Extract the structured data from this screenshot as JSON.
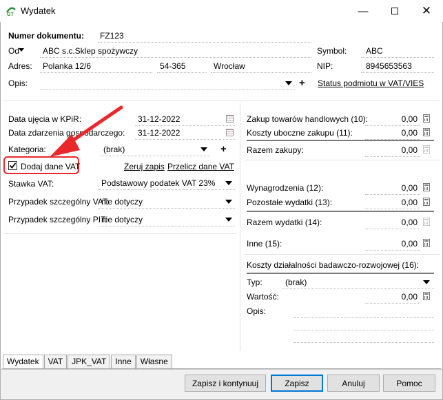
{
  "window": {
    "title": "Wydatek"
  },
  "header": {
    "doc_number_label": "Numer dokumentu:",
    "doc_number": "FZ123",
    "from_label": "Od",
    "from_value": "ABC s.c.Sklep spożywczy",
    "symbol_label": "Symbol:",
    "symbol_value": "ABC",
    "address_label": "Adres:",
    "street": "Polanka  12/6",
    "postcode": "54-365",
    "city": "Wrocław",
    "nip_label": "NIP:",
    "nip_value": "8945653563",
    "desc_label": "Opis:",
    "desc_value": "",
    "vat_status_link": "Status podmiotu w VAT/VIES"
  },
  "left": {
    "kpir_date_label": "Data ujęcia w KPiR:",
    "kpir_date": "31-12-2022",
    "event_date_label": "Data zdarzenia gospodarczego:",
    "event_date": "31-12-2022",
    "category_label": "Kategoria:",
    "category_value": "(brak)",
    "add_vat_label": "Dodaj dane VAT",
    "clear_link": "Zeruj zapis",
    "recalc_link": "Przelicz dane VAT",
    "vat_rate_label": "Stawka VAT:",
    "vat_rate_value": "Podstawowy podatek VAT 23%",
    "special_vat_label": "Przypadek szczególny VAT:",
    "special_vat_value": "nie dotyczy",
    "special_pit_label": "Przypadek szczególny PIT:",
    "special_pit_value": "nie dotyczy"
  },
  "right": {
    "goods_label": "Zakup towarów handlowych (10):",
    "goods_value": "0,00",
    "side_costs_label": "Koszty uboczne zakupu (11):",
    "side_costs_value": "0,00",
    "total_purchase_label": "Razem zakupy:",
    "total_purchase_value": "0,00",
    "salaries_label": "Wynagrodzenia (12):",
    "salaries_value": "0,00",
    "other_exp_label": "Pozostałe wydatki (13):",
    "other_exp_value": "0,00",
    "total_exp_label": "Razem wydatki (14):",
    "total_exp_value": "0,00",
    "other_label": "Inne (15):",
    "other_value": "0,00",
    "rd_label": "Koszty działalności badawczo-rozwojowej (16):",
    "type_label": "Typ:",
    "type_value": "(brak)",
    "amount_label": "Wartość:",
    "amount_value": "0,00",
    "desc_label": "Opis:"
  },
  "tabs": [
    "Wydatek",
    "VAT",
    "JPK_VAT",
    "Inne",
    "Własne"
  ],
  "buttons": {
    "save_continue": "Zapisz i kontynuuj",
    "save": "Zapisz",
    "cancel": "Anuluj",
    "help": "Pomoc"
  },
  "colors": {
    "highlight": "#e8282b",
    "focus": "#0078d7"
  },
  "icons": {
    "app": "app-logo-icon",
    "calendar": "calendar-icon",
    "calculator": "calculator-icon"
  }
}
